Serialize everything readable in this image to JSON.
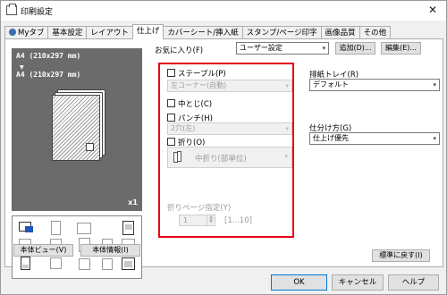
{
  "window": {
    "title": "印刷設定",
    "close": "✕"
  },
  "tabs": [
    {
      "label": "Myタブ"
    },
    {
      "label": "基本設定"
    },
    {
      "label": "レイアウト"
    },
    {
      "label": "仕上げ"
    },
    {
      "label": "カバーシート/挿入紙"
    },
    {
      "label": "スタンプ/ページ印字"
    },
    {
      "label": "画像品質"
    },
    {
      "label": "その他"
    }
  ],
  "preview": {
    "paper_size_1": "A4 (210x297 mm)",
    "arrow": "▼",
    "paper_size_2": "A4 (210x297 mm)",
    "copies": "x1"
  },
  "left_buttons": {
    "printer_view": "本体ビュー(V)",
    "printer_info": "本体情報(I)"
  },
  "favorites": {
    "label": "お気に入り(F)",
    "value": "ユーザー設定",
    "add": "追加(D)...",
    "edit": "編集(E)..."
  },
  "finishing": {
    "staple": {
      "label": "ステープル(P)",
      "value": "左コーナー(自動)"
    },
    "center_staple": {
      "label": "中とじ(C)"
    },
    "punch": {
      "label": "パンチ(H)",
      "value": "2穴(左)"
    },
    "fold": {
      "label": "折り(O)",
      "value": "中折り(部単位)"
    },
    "fold_pages": {
      "label": "折りページ指定(Y)",
      "value": "1",
      "range": "[1...10]"
    }
  },
  "output_tray": {
    "label": "排紙トレイ(R)",
    "value": "デフォルト"
  },
  "collate": {
    "label": "仕分け方(G)",
    "value": "仕上げ優先"
  },
  "buttons": {
    "defaults": "標準に戻す(I)",
    "ok": "OK",
    "cancel": "キャンセル",
    "help": "ヘルプ"
  },
  "colors": {
    "highlight_frame": "#e30613",
    "preview_bg": "#6b6b6b",
    "focus": "#0078d7",
    "icon_blue": "#1d56b8"
  }
}
